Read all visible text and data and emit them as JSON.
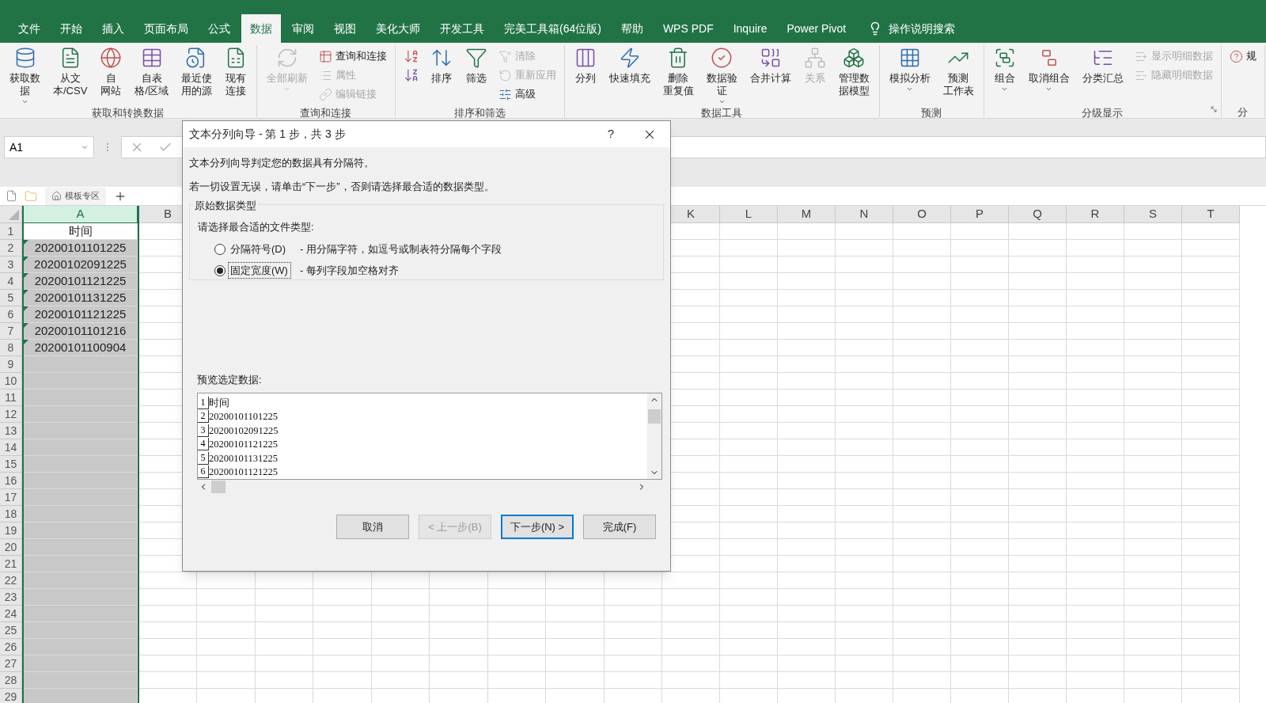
{
  "ribbon_tabs": [
    {
      "label": "文件",
      "selected": false
    },
    {
      "label": "开始",
      "selected": false
    },
    {
      "label": "插入",
      "selected": false
    },
    {
      "label": "页面布局",
      "selected": false
    },
    {
      "label": "公式",
      "selected": false
    },
    {
      "label": "数据",
      "selected": true
    },
    {
      "label": "审阅",
      "selected": false
    },
    {
      "label": "视图",
      "selected": false
    },
    {
      "label": "美化大师",
      "selected": false
    },
    {
      "label": "开发工具",
      "selected": false
    },
    {
      "label": "完美工具箱(64位版)",
      "selected": false
    },
    {
      "label": "帮助",
      "selected": false
    },
    {
      "label": "WPS PDF",
      "selected": false
    },
    {
      "label": "Inquire",
      "selected": false
    },
    {
      "label": "Power Pivot",
      "selected": false
    }
  ],
  "search_hint": "操作说明搜索",
  "ribbon_groups": [
    {
      "label": "获取和转换数据",
      "launcher": false,
      "buttons": [
        {
          "kind": "large",
          "lines": [
            "获取数",
            "据"
          ],
          "dropdown": true,
          "disabled": false
        },
        {
          "kind": "large",
          "lines": [
            "从文",
            "本/CSV"
          ],
          "dropdown": false,
          "disabled": false
        },
        {
          "kind": "large",
          "lines": [
            "自",
            "网站"
          ],
          "dropdown": false,
          "disabled": false
        },
        {
          "kind": "large",
          "lines": [
            "自表",
            "格/区域"
          ],
          "dropdown": false,
          "disabled": false
        },
        {
          "kind": "large",
          "lines": [
            "最近使",
            "用的源"
          ],
          "dropdown": false,
          "disabled": false
        },
        {
          "kind": "large",
          "lines": [
            "现有",
            "连接"
          ],
          "dropdown": false,
          "disabled": false
        }
      ]
    },
    {
      "label": "查询和连接",
      "launcher": false,
      "buttons": [
        {
          "kind": "large",
          "lines": [
            "全部刷新"
          ],
          "dropdown": true,
          "disabled": true
        },
        {
          "kind": "small",
          "lines": [
            "查询和连接"
          ],
          "disabled": false
        },
        {
          "kind": "small",
          "lines": [
            "属性"
          ],
          "disabled": true
        },
        {
          "kind": "small",
          "lines": [
            "编辑链接"
          ],
          "disabled": true
        }
      ]
    },
    {
      "label": "排序和筛选",
      "launcher": false,
      "buttons": [
        {
          "kind": "icon",
          "disabled": false
        },
        {
          "kind": "icon",
          "disabled": false
        },
        {
          "kind": "large",
          "lines": [
            "排序"
          ],
          "dropdown": false,
          "disabled": false
        },
        {
          "kind": "large",
          "lines": [
            "筛选"
          ],
          "dropdown": false,
          "disabled": false
        },
        {
          "kind": "small",
          "lines": [
            "清除"
          ],
          "disabled": true
        },
        {
          "kind": "small",
          "lines": [
            "重新应用"
          ],
          "disabled": true
        },
        {
          "kind": "small",
          "lines": [
            "高级"
          ],
          "disabled": false
        }
      ]
    },
    {
      "label": "数据工具",
      "launcher": false,
      "buttons": [
        {
          "kind": "large",
          "lines": [
            "分列"
          ],
          "dropdown": false,
          "disabled": false
        },
        {
          "kind": "large",
          "lines": [
            "快速填充"
          ],
          "dropdown": false,
          "disabled": false
        },
        {
          "kind": "large",
          "lines": [
            "删除",
            "重复值"
          ],
          "dropdown": false,
          "disabled": false
        },
        {
          "kind": "large",
          "lines": [
            "数据验",
            "证"
          ],
          "dropdown": true,
          "disabled": false
        },
        {
          "kind": "large",
          "lines": [
            "合并计算"
          ],
          "dropdown": false,
          "disabled": false
        },
        {
          "kind": "large",
          "lines": [
            "关系"
          ],
          "dropdown": false,
          "disabled": true
        },
        {
          "kind": "large",
          "lines": [
            "管理数",
            "据模型"
          ],
          "dropdown": false,
          "disabled": false
        }
      ]
    },
    {
      "label": "预测",
      "launcher": false,
      "buttons": [
        {
          "kind": "large",
          "lines": [
            "模拟分析"
          ],
          "dropdown": true,
          "disabled": false
        },
        {
          "kind": "large",
          "lines": [
            "预测",
            "工作表"
          ],
          "dropdown": false,
          "disabled": false
        }
      ]
    },
    {
      "label": "分级显示",
      "launcher": true,
      "buttons": [
        {
          "kind": "large",
          "lines": [
            "组合"
          ],
          "dropdown": true,
          "disabled": false
        },
        {
          "kind": "large",
          "lines": [
            "取消组合"
          ],
          "dropdown": true,
          "disabled": false
        },
        {
          "kind": "large",
          "lines": [
            "分类汇总"
          ],
          "dropdown": false,
          "disabled": false
        },
        {
          "kind": "small",
          "lines": [
            "显示明细数据"
          ],
          "disabled": true
        },
        {
          "kind": "small",
          "lines": [
            "隐藏明细数据"
          ],
          "disabled": true
        }
      ]
    },
    {
      "label": "分",
      "launcher": false,
      "buttons": [
        {
          "kind": "small",
          "lines": [
            "规"
          ],
          "disabled": false
        }
      ]
    }
  ],
  "name_box": "A1",
  "sheet_tabs": [
    {
      "label": "模板专区"
    }
  ],
  "columns": [
    {
      "label": "A",
      "selected": true
    },
    {
      "label": "B",
      "selected": false
    },
    {
      "label": "K",
      "selected": false
    },
    {
      "label": "L",
      "selected": false
    },
    {
      "label": "M",
      "selected": false
    },
    {
      "label": "N",
      "selected": false
    },
    {
      "label": "O",
      "selected": false
    },
    {
      "label": "P",
      "selected": false
    },
    {
      "label": "Q",
      "selected": false
    },
    {
      "label": "R",
      "selected": false
    },
    {
      "label": "S",
      "selected": false
    },
    {
      "label": "T",
      "selected": false
    }
  ],
  "rows": [
    "1",
    "2",
    "3",
    "4",
    "5",
    "6",
    "7",
    "8",
    "9",
    "10",
    "11",
    "12",
    "13",
    "14",
    "15",
    "16",
    "17",
    "18",
    "19",
    "20",
    "21",
    "22",
    "23",
    "24",
    "25",
    "26",
    "27",
    "28",
    "29"
  ],
  "cells": [
    {
      "text": "时间",
      "flagged": false,
      "active": true
    },
    {
      "text": "20200101101225",
      "flagged": true,
      "active": false
    },
    {
      "text": "20200102091225",
      "flagged": true,
      "active": false
    },
    {
      "text": "20200101121225",
      "flagged": true,
      "active": false
    },
    {
      "text": "20200101131225",
      "flagged": true,
      "active": false
    },
    {
      "text": "20200101121225",
      "flagged": true,
      "active": false
    },
    {
      "text": "20200101101216",
      "flagged": true,
      "active": false
    },
    {
      "text": "20200101100904",
      "flagged": true,
      "active": false
    }
  ],
  "dialog": {
    "title": "文本分列向导 - 第 1 步，共 3 步",
    "help": "?",
    "intro": "文本分列向导判定您的数据具有分隔符。",
    "instruction": "若一切设置无误，请单击“下一步”，否则请选择最合适的数据类型。",
    "group_label": "原始数据类型",
    "prompt": "请选择最合适的文件类型:",
    "options": [
      {
        "label": "分隔符号(D)",
        "description": "- 用分隔字符，如逗号或制表符分隔每个字段",
        "selected": false
      },
      {
        "label": "固定宽度(W)",
        "description": "- 每列字段加空格对齐",
        "selected": true
      }
    ],
    "preview_label": "预览选定数据:",
    "preview_rows": [
      {
        "number": "1",
        "text": "时间"
      },
      {
        "number": "2",
        "text": "20200101101225"
      },
      {
        "number": "3",
        "text": "20200102091225"
      },
      {
        "number": "4",
        "text": "20200101121225"
      },
      {
        "number": "5",
        "text": "20200101131225"
      },
      {
        "number": "6",
        "text": "20200101121225"
      }
    ],
    "buttons": [
      {
        "label": "取消",
        "disabled": false,
        "default": false
      },
      {
        "label": "< 上一步(B)",
        "disabled": true,
        "default": false
      },
      {
        "label": "下一步(N) >",
        "disabled": false,
        "default": true
      },
      {
        "label": "完成(F)",
        "disabled": false,
        "default": false
      }
    ]
  }
}
